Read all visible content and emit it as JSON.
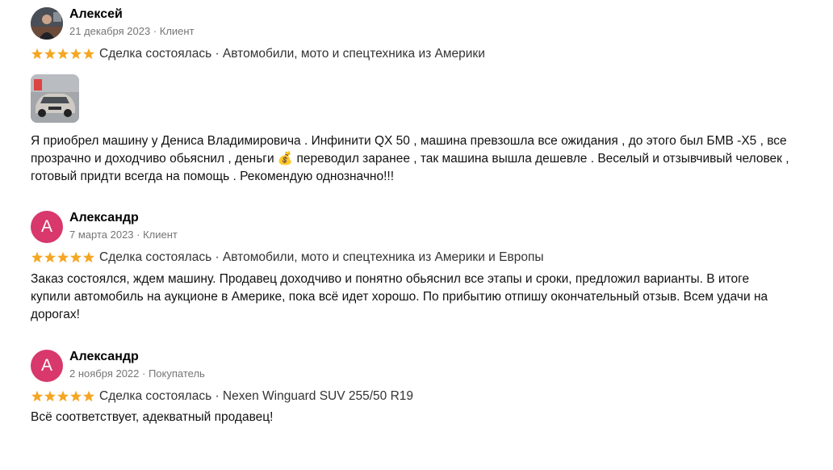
{
  "colors": {
    "star": "#f5a623",
    "avatar_bg": "#d8386c",
    "meta": "#757575"
  },
  "reviews": [
    {
      "name": "Алексей",
      "meta": "21 декабря 2023 · Клиент",
      "rating": 5,
      "deal": "Сделка состоялась · Автомобили, мото и спецтехника из Америки",
      "text": "Я приобрел машину у Дениса Владимировича . Инфинити QX 50 , машина превзошла все ожидания , до этого был БМВ -X5 , все прозрачно и доходчиво обьяснил , деньги 💰 переводил заранее , так машина вышла дешевле . Веселый и отзывчивый человек , готовый придти всегда на помощь . Рекомендую однозначно!!!"
    },
    {
      "name": "Александр",
      "avatar_letter": "А",
      "meta": "7 марта 2023 · Клиент",
      "rating": 5,
      "deal": "Сделка состоялась · Автомобили, мото и спецтехника из Америки и Европы",
      "text": "Заказ состоялся, ждем машину. Продавец доходчиво и понятно обьяснил все этапы и сроки, предложил варианты. В итоге купили автомобиль на аукционе в Америке, пока всё идет хорошо. По прибытию отпишу окончательный отзыв. Всем удачи на дорогах!"
    },
    {
      "name": "Александр",
      "avatar_letter": "А",
      "meta": "2 ноября 2022 · Покупатель",
      "rating": 5,
      "deal": "Сделка состоялась · Nexen Winguard SUV 255/50 R19",
      "text": "Всё соответствует, адекватный продавец!"
    }
  ]
}
